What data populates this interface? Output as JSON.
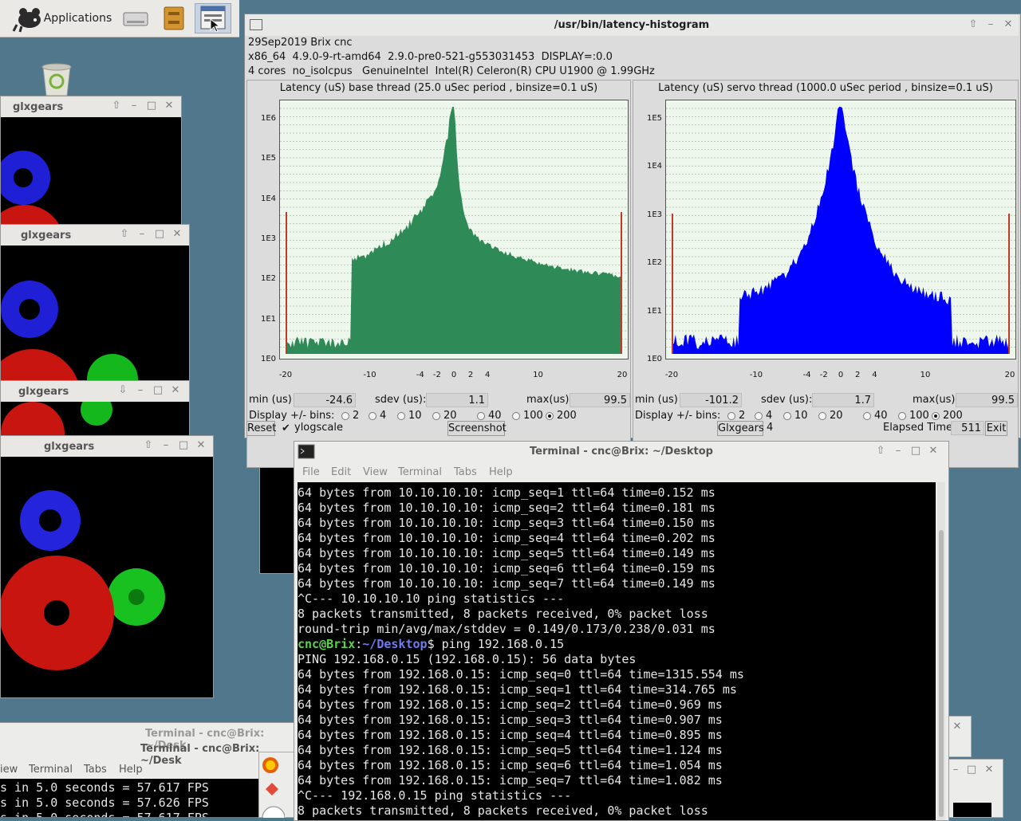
{
  "top_panel": {
    "applications_label": "Applications"
  },
  "latency_window": {
    "title": "/usr/bin/latency-histogram",
    "info_line1": "29Sep2019 Brix cnc",
    "info_line2": "x86_64  4.9.0-9-rt-amd64  2.9.0-pre0-521-g553031453  DISPLAY=:0.0",
    "info_line3": "4 cores  no_isolcpus   GenuineIntel  Intel(R) Celeron(R) CPU U1900 @ 1.99GHz",
    "base": {
      "title": "Latency (uS) base thread (25.0 uSec period , binsize=0.1 uS)",
      "min_label": "min (us)",
      "min_value": "-24.6",
      "sdev_label": "sdev (us):",
      "sdev_value": "1.1",
      "max_label": "max(us)",
      "max_value": "99.5",
      "ylabels": [
        "1E6",
        "1E5",
        "1E4",
        "1E3",
        "1E2",
        "1E1",
        "1E0"
      ],
      "xlabels": [
        "-20",
        "-10",
        "-4",
        "-2",
        "0",
        "2",
        "4",
        "10",
        "20"
      ]
    },
    "servo": {
      "title": "Latency (uS) servo thread (1000.0 uSec period , binsize=0.1 uS)",
      "min_label": "min (us)",
      "min_value": "-101.2",
      "sdev_label": "sdev (us):",
      "sdev_value": "1.7",
      "max_label": "max(us)",
      "max_value": "99.5",
      "ylabels": [
        "1E5",
        "1E4",
        "1E3",
        "1E2",
        "1E1",
        "1E0"
      ],
      "xlabels": [
        "-20",
        "-10",
        "-4",
        "-2",
        "0",
        "2",
        "4",
        "10",
        "20"
      ]
    },
    "display_bins_label": "Display +/- bins:",
    "bin_options": [
      "2",
      "4",
      "10",
      "20",
      "40",
      "100",
      "200"
    ],
    "bin_selected": "200",
    "reset_label": "Reset",
    "ylogscale_label": "ylogscale",
    "screenshot_label": "Screenshot",
    "glxgears_label": "Glxgears",
    "glxgears_count": "4",
    "elapsed_label": "Elapsed Time:",
    "elapsed_value": "511",
    "exit_label": "Exit",
    "colors": {
      "base": "#2e8b57",
      "servo": "#0000ff"
    }
  },
  "glxgears_windows": [
    {
      "title": "glxgears"
    },
    {
      "title": "glxgears"
    },
    {
      "title": "glxgears"
    },
    {
      "title": "glxgears"
    }
  ],
  "terminal": {
    "title": "Terminal - cnc@Brix: ~/Desktop",
    "menu": [
      "File",
      "Edit",
      "View",
      "Terminal",
      "Tabs",
      "Help"
    ],
    "lines": [
      "64 bytes from 10.10.10.10: icmp_seq=1 ttl=64 time=0.152 ms",
      "64 bytes from 10.10.10.10: icmp_seq=2 ttl=64 time=0.181 ms",
      "64 bytes from 10.10.10.10: icmp_seq=3 ttl=64 time=0.150 ms",
      "64 bytes from 10.10.10.10: icmp_seq=4 ttl=64 time=0.202 ms",
      "64 bytes from 10.10.10.10: icmp_seq=5 ttl=64 time=0.149 ms",
      "64 bytes from 10.10.10.10: icmp_seq=6 ttl=64 time=0.159 ms",
      "64 bytes from 10.10.10.10: icmp_seq=7 ttl=64 time=0.149 ms",
      "^C--- 10.10.10.10 ping statistics ---",
      "8 packets transmitted, 8 packets received, 0% packet loss",
      "round-trip min/avg/max/stddev = 0.149/0.173/0.238/0.031 ms",
      "",
      "PING 192.168.0.15 (192.168.0.15): 56 data bytes",
      "64 bytes from 192.168.0.15: icmp_seq=0 ttl=64 time=1315.554 ms",
      "64 bytes from 192.168.0.15: icmp_seq=1 ttl=64 time=314.765 ms",
      "64 bytes from 192.168.0.15: icmp_seq=2 ttl=64 time=0.969 ms",
      "64 bytes from 192.168.0.15: icmp_seq=3 ttl=64 time=0.907 ms",
      "64 bytes from 192.168.0.15: icmp_seq=4 ttl=64 time=0.895 ms",
      "64 bytes from 192.168.0.15: icmp_seq=5 ttl=64 time=1.124 ms",
      "64 bytes from 192.168.0.15: icmp_seq=6 ttl=64 time=1.054 ms",
      "64 bytes from 192.168.0.15: icmp_seq=7 ttl=64 time=1.082 ms",
      "^C--- 192.168.0.15 ping statistics ---",
      "8 packets transmitted, 8 packets received, 0% packet loss"
    ],
    "prompt_user": "cnc@Brix",
    "prompt_path": "~/Desktop",
    "prompt_cmd": "$ ping 192.168.0.15"
  },
  "bottom_terminal": {
    "title_back": "Terminal - cnc@Brix: ~/Desk",
    "title_front": "Terminal - cnc@Brix: ~/Desk",
    "menu": [
      "iew",
      "Terminal",
      "Tabs",
      "Help"
    ],
    "lines": [
      "s in 5.0 seconds = 57.617 FPS",
      "s in 5.0 seconds = 57.626 FPS"
    ]
  }
}
